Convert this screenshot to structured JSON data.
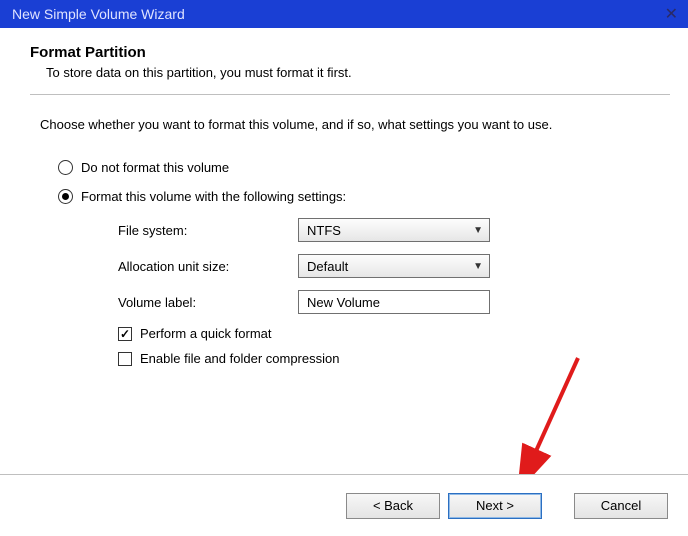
{
  "titlebar": {
    "title": "New Simple Volume Wizard"
  },
  "header": {
    "title": "Format Partition",
    "subtitle": "To store data on this partition, you must format it first."
  },
  "instruction": "Choose whether you want to format this volume, and if so, what settings you want to use.",
  "radio": {
    "noformat": "Do not format this volume",
    "format": "Format this volume with the following settings:"
  },
  "settings": {
    "filesystem_label": "File system:",
    "filesystem_value": "NTFS",
    "alloc_label": "Allocation unit size:",
    "alloc_value": "Default",
    "vollabel_label": "Volume label:",
    "vollabel_value": "New Volume",
    "quickformat": "Perform a quick format",
    "compression": "Enable file and folder compression"
  },
  "buttons": {
    "back": "< Back",
    "next": "Next >",
    "cancel": "Cancel"
  }
}
